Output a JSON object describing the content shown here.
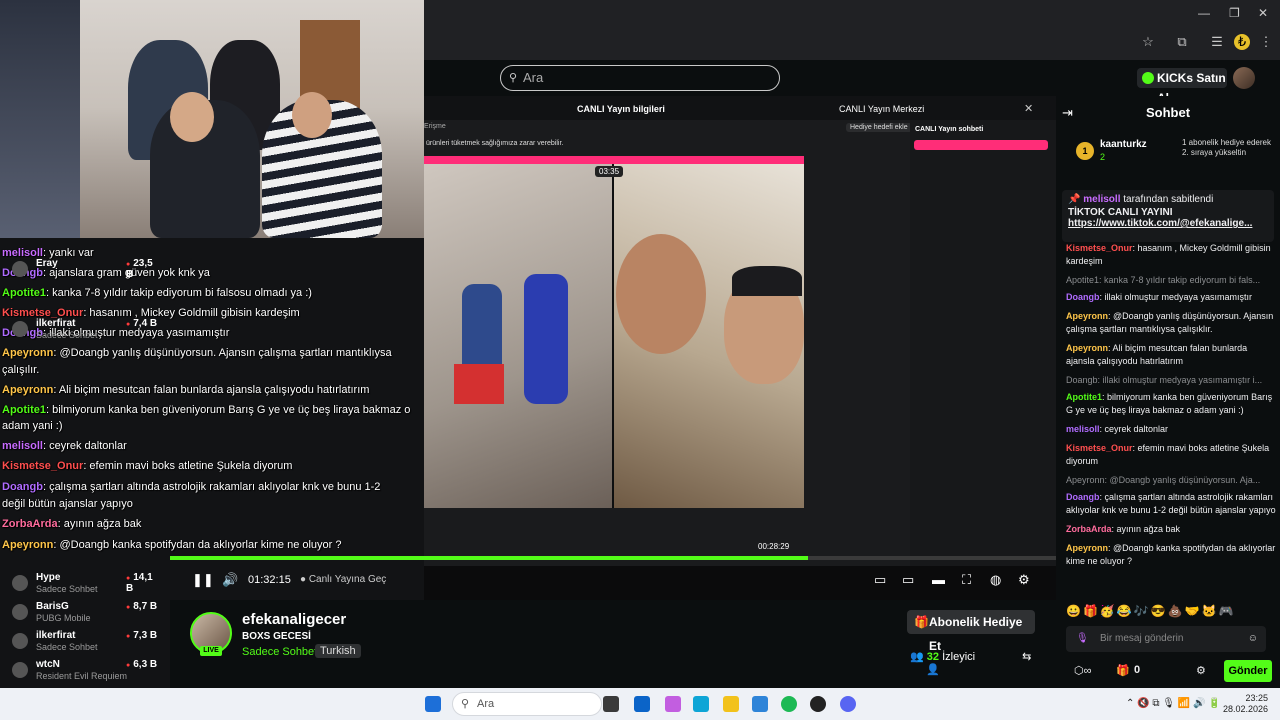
{
  "search": {
    "placeholder": "Ara"
  },
  "header": {
    "kicks_label": "KICKs Satın Al"
  },
  "inner_window": {
    "title": "CANLI Yayın bilgileri",
    "center_label": "CANLI Yayın Merkezi",
    "gift_goal": "Hediye hedefi ekle",
    "warning": "ürünleri tüketmek sağlığımıza zarar verebilir.",
    "timer": "03:35",
    "inner_chat_title": "CANLI Yayın sohbeti",
    "record_time": "00:28:29",
    "left_label": "Erişme"
  },
  "player": {
    "time": "01:32:15",
    "live_label": "Canlı Yayına Geç"
  },
  "channel": {
    "name": "efekanaligecer",
    "title": "BOXS GECESİ",
    "category": "Sadece Sohbet",
    "language": "Turkish",
    "live": "LIVE",
    "gift_button": "Abonelik Hediye Et",
    "viewer_count": "32",
    "viewer_label": "İzleyici"
  },
  "chat": {
    "title": "Sohbet",
    "top_gifter": "kaanturkz",
    "top_gifter_count": "2",
    "subgift_text": "1 abonelik hediye ederek 2. sıraya yükseltin",
    "pinned_by": "melisoll",
    "pinned_suffix": "tarafından sabitlendi",
    "pinned_title": "TİKTOK CANLI YAYINI",
    "pinned_link": "https://www.tiktok.com/@efekanalige...",
    "messages": [
      {
        "user": "Kismetse_Onur",
        "color": "#ff4f4f",
        "text": ": hasanım , Mickey Goldmill gibisin kardeşim"
      },
      {
        "sys": "Apotite1: kanka 7-8 yıldır takip ediyorum bi fals..."
      },
      {
        "user": "Doangb",
        "color": "#b06cff",
        "text": ": illaki olmuştur medyaya yasımamıştır"
      },
      {
        "user": "Apeyronn",
        "color": "#ffc64a",
        "text": ": @Doangb yanlış düşünüyorsun. Ajansın çalışma şartları mantıklıysa çalışıklır."
      },
      {
        "user": "Apeyronn",
        "color": "#ffc64a",
        "text": ": Ali biçim mesutcan falan bunlarda ajansla çalışıyodu hatırlatırım"
      },
      {
        "sys": "Doangb: illaki olmuştur medyaya yasımamıştır i..."
      },
      {
        "user": "Apotite1",
        "color": "#53fc18",
        "text": ": bilmiyorum kanka ben güveniyorum Barış G ye ve üç beş liraya bakmaz o adam yani :)"
      },
      {
        "user": "melisoll",
        "color": "#b06cff",
        "text": ": ceyrek daltonlar"
      },
      {
        "user": "Kismetse_Onur",
        "color": "#ff4f4f",
        "text": ": efemin mavi boks atletine Şukela diyorum"
      },
      {
        "sys": "Apeyronn: @Doangb yanlış düşünüyorsun. Aja..."
      },
      {
        "user": "Doangb",
        "color": "#b06cff",
        "text": ": çalışma şartları altında astrolojik rakamları aklıyolar knk ve bunu 1-2 değil bütün ajanslar yapıyo"
      },
      {
        "user": "ZorbaArda",
        "color": "#ff6c9d",
        "text": ": ayının ağza bak"
      },
      {
        "user": "Apeyronn",
        "color": "#ffc64a",
        "text": ": @Doangb kanka spotifydan da aklıyorlar kime ne oluyor ?"
      }
    ],
    "input_placeholder": "Bir mesaj gönderin",
    "points": "0",
    "send_label": "Gönder"
  },
  "overlay_chat": [
    {
      "user": "melisoll",
      "color": "#c86cff",
      "text": ": yankı var",
      "top": 1
    },
    {
      "user": "Doangb",
      "color": "#b06cff",
      "text": ": ajanslara gram güven yok knk ya"
    },
    {
      "user": "Apotite1",
      "color": "#53fc18",
      "text": ": kanka 7-8 yıldır takip ediyorum bi falsosu olmadı ya :)"
    },
    {
      "user": "Kismetse_Onur",
      "color": "#ff4f4f",
      "text": ": hasanım , Mickey Goldmill gibisin kardeşim"
    },
    {
      "user": "Doangb",
      "color": "#b06cff",
      "text": ": illaki olmuştur medyaya yasımamıştır"
    },
    {
      "user": "Apeyronn",
      "color": "#ffc64a",
      "text": ": @Doangb yanlış düşünüyorsun. Ajansın çalışma şartları mantıklıysa"
    },
    {
      "user": "",
      "color": "#fff",
      "text": "çalışılır."
    },
    {
      "user": "Apeyronn",
      "color": "#ffc64a",
      "text": ": Ali biçim mesutcan falan bunlarda ajansla çalışıyodu hatırlatırım"
    },
    {
      "user": "Apotite1",
      "color": "#53fc18",
      "text": ": bilmiyorum kanka ben güveniyorum Barış G ye ve üç beş liraya bakmaz o"
    },
    {
      "user": "",
      "color": "#fff",
      "text": "adam yani :)"
    },
    {
      "user": "melisoll",
      "color": "#c86cff",
      "text": ": ceyrek daltonlar"
    },
    {
      "user": "Kismetse_Onur",
      "color": "#ff4f4f",
      "text": ": efemin mavi boks atletine Şukela diyorum"
    },
    {
      "user": "Doangb",
      "color": "#b06cff",
      "text": ": çalışma şartları altında astrolojik rakamları aklıyolar knk ve bunu 1-2"
    },
    {
      "user": "",
      "color": "#fff",
      "text": "değil bütün ajanslar yapıyo"
    },
    {
      "user": "ZorbaArda",
      "color": "#ff6c9d",
      "text": ": ayının ağza bak"
    },
    {
      "user": "Apeyronn",
      "color": "#ffc64a",
      "text": ": @Doangb kanka spotifydan da aklıyorlar kime ne oluyor ?"
    }
  ],
  "viewer_list": [
    {
      "name": "Eray",
      "category": "",
      "value": "23,5 B"
    },
    {
      "name": "ilkerfirat",
      "category": "Sadece Sohbet",
      "value": "7,4 B"
    },
    {
      "name": "Hype",
      "category": "Sadece Sohbet",
      "value": "14,1 B"
    },
    {
      "name": "BarisG",
      "category": "PUBG Mobile",
      "value": "8,7 B"
    },
    {
      "name": "ilkerfirat",
      "category": "Sadece Sohbet",
      "value": "7,3 B"
    },
    {
      "name": "wtcN",
      "category": "Resident Evil Requiem",
      "value": "6,3 B"
    }
  ],
  "taskbar": {
    "search": "Ara",
    "time": "23:25",
    "date": "28.02.2026"
  }
}
